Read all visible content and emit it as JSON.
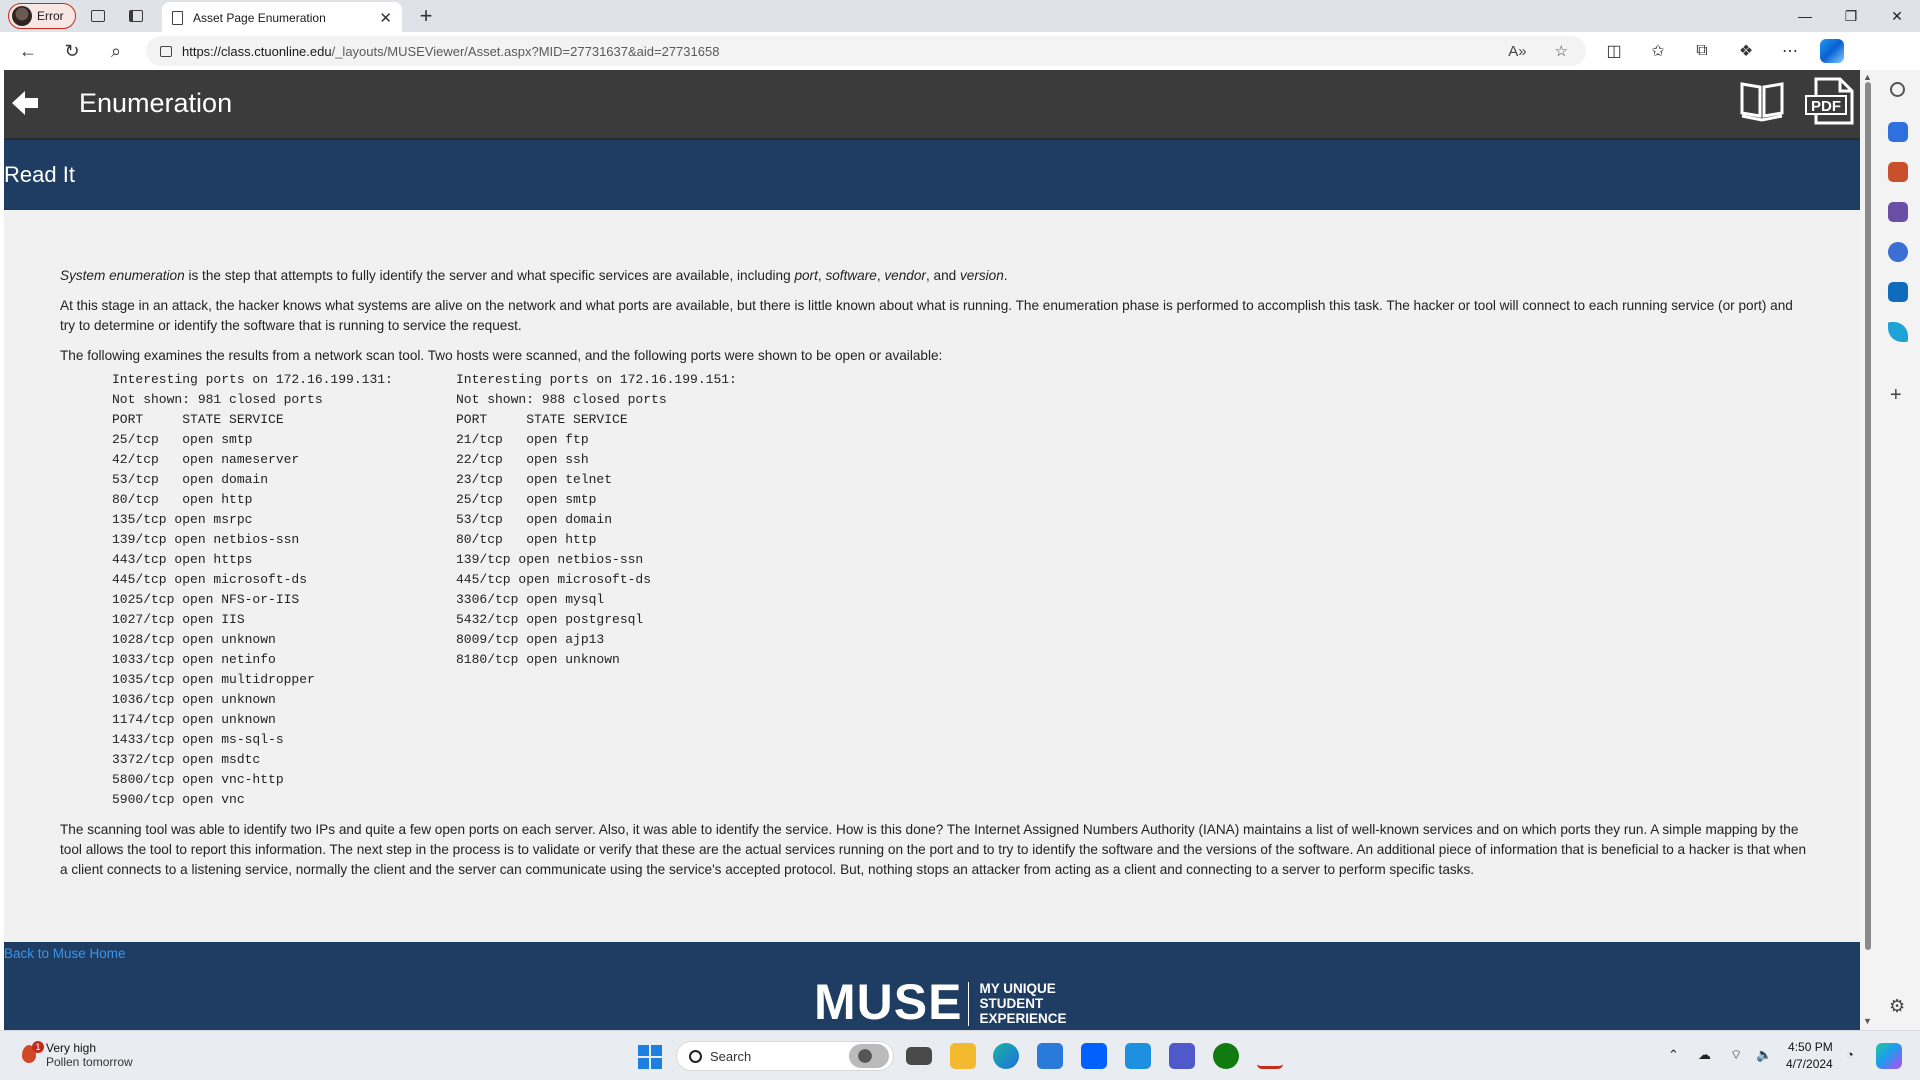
{
  "browser": {
    "profile_label": "Error",
    "tab_title": "Asset Page Enumeration",
    "url_host": "https://class.ctuonline.edu",
    "url_path": "/_layouts/MUSEViewer/Asset.aspx?MID=27731637&aid=27731658"
  },
  "page": {
    "header_title": "Enumeration",
    "section_title": "Read It",
    "p1": {
      "em1": "System enumeration",
      "mid": " is the step that attempts to fully identify the server and what specific services are available, including ",
      "em2": "port",
      "c1": ", ",
      "em3": "software",
      "c2": ", ",
      "em4": "vendor",
      "c3": ", and ",
      "em5": "version",
      "end": "."
    },
    "p2": "At this stage in an attack, the hacker knows what systems are alive on the network and what ports are available, but there is little known about what is running. The enumeration phase is performed to accomplish this task. The hacker or tool will connect to each running service (or port) and try to determine or identify the software that is running to service the request.",
    "p3": "The following examines the results from a network scan tool. Two hosts were scanned, and the following ports were shown to be open or available:",
    "scan_left": [
      "Interesting ports on 172.16.199.131:",
      "Not shown: 981 closed ports",
      "PORT     STATE SERVICE",
      "25/tcp   open smtp",
      "42/tcp   open nameserver",
      "53/tcp   open domain",
      "80/tcp   open http",
      "135/tcp open msrpc",
      "139/tcp open netbios-ssn",
      "443/tcp open https",
      "445/tcp open microsoft-ds",
      "1025/tcp open NFS-or-IIS",
      "1027/tcp open IIS",
      "1028/tcp open unknown",
      "1033/tcp open netinfo",
      "1035/tcp open multidropper",
      "1036/tcp open unknown",
      "1174/tcp open unknown",
      "1433/tcp open ms-sql-s",
      "3372/tcp open msdtc",
      "5800/tcp open vnc-http",
      "5900/tcp open vnc"
    ],
    "scan_right": [
      "Interesting ports on 172.16.199.151:",
      "Not shown: 988 closed ports",
      "PORT     STATE SERVICE",
      "21/tcp   open ftp",
      "22/tcp   open ssh",
      "23/tcp   open telnet",
      "25/tcp   open smtp",
      "53/tcp   open domain",
      "80/tcp   open http",
      "139/tcp open netbios-ssn",
      "445/tcp open microsoft-ds",
      "3306/tcp open mysql",
      "5432/tcp open postgresql",
      "8009/tcp open ajp13",
      "8180/tcp open unknown"
    ],
    "p4": "The scanning tool was able to identify two IPs and quite a few open ports on each server. Also, it was able to identify the service. How is this done? The Internet Assigned Numbers Authority (IANA) maintains a list of well-known services and on which ports they run. A simple mapping by the tool allows the tool to report this information. The next step in the process is to validate or verify that these are the actual services running on the port and to try to identify the software and the versions of the software. An additional piece of information that is beneficial to a hacker is that when a client connects to a listening service, normally the client and the server can communicate using the service's accepted protocol. But, nothing stops an attacker from acting as a client and connecting to a server to perform specific tasks.",
    "footer_link": "Back to Muse Home",
    "logo_big": "MUSE",
    "logo_tag1": "MY UNIQUE",
    "logo_tag2": "STUDENT",
    "logo_tag3": "EXPERIENCE"
  },
  "taskbar": {
    "weather_line1": "Very high",
    "weather_line2": "Pollen tomorrow",
    "weather_badge": "1",
    "search_label": "Search",
    "time": "4:50 PM",
    "date": "4/7/2024"
  },
  "colors": {
    "header_dark": "#3b3b3b",
    "navy": "#1f3c62",
    "link": "#3a95e8"
  }
}
